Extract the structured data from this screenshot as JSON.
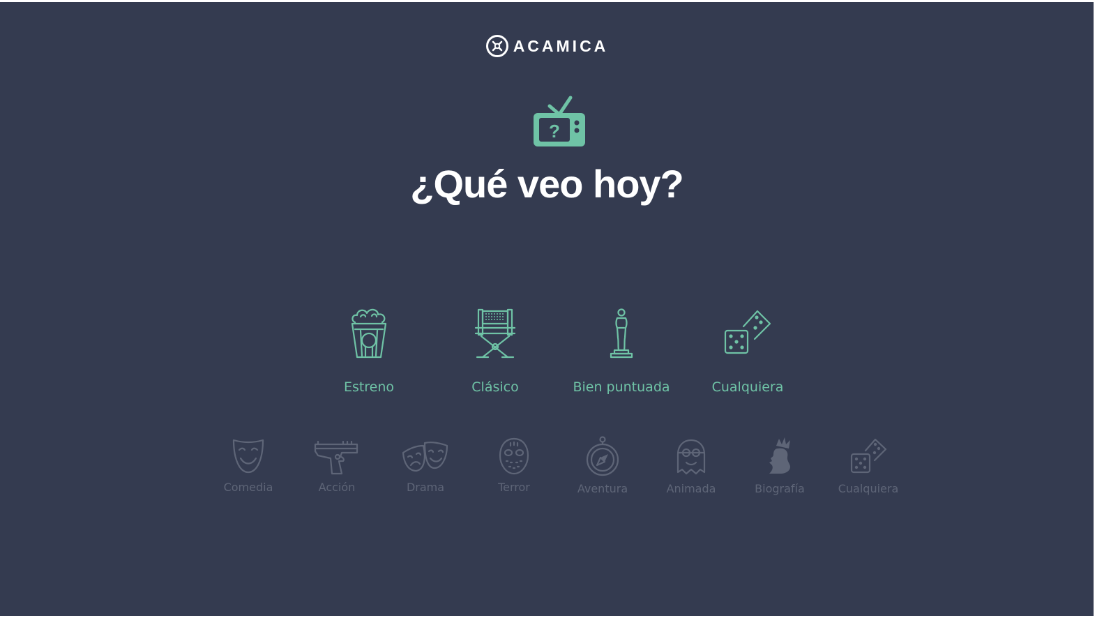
{
  "brand": {
    "name": "ACAMICA",
    "icon": "acamica-logo-icon"
  },
  "hero": {
    "icon": "tv-question-icon",
    "title": "¿Qué veo hoy?"
  },
  "options": [
    {
      "label": "Estreno",
      "icon": "popcorn-icon"
    },
    {
      "label": "Clásico",
      "icon": "director-chair-icon"
    },
    {
      "label": "Bien puntuada",
      "icon": "oscar-statue-icon"
    },
    {
      "label": "Cualquiera",
      "icon": "dice-icon"
    }
  ],
  "genres": [
    {
      "label": "Comedia",
      "icon": "comedy-mask-icon"
    },
    {
      "label": "Acción",
      "icon": "pistol-icon"
    },
    {
      "label": "Drama",
      "icon": "drama-masks-icon"
    },
    {
      "label": "Terror",
      "icon": "hockey-mask-icon"
    },
    {
      "label": "Aventura",
      "icon": "compass-icon"
    },
    {
      "label": "Animada",
      "icon": "minion-icon"
    },
    {
      "label": "Biografía",
      "icon": "queen-profile-icon"
    },
    {
      "label": "Cualquiera",
      "icon": "dice-icon"
    }
  ],
  "colors": {
    "background": "#343b50",
    "accent": "#6fc3a6",
    "muted": "#5e6577",
    "text": "#ffffff"
  }
}
